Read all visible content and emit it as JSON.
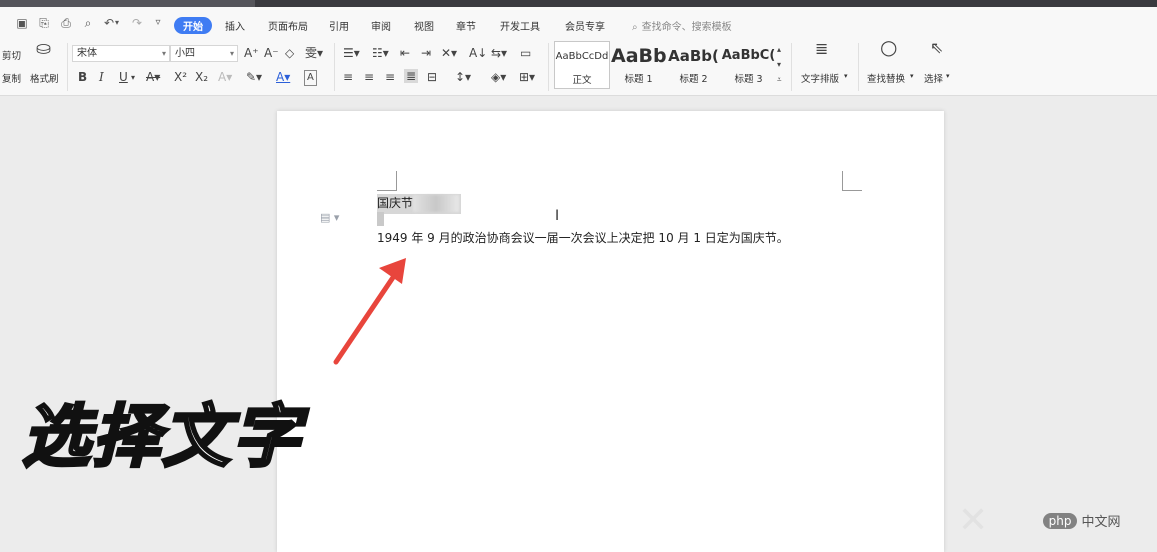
{
  "tabs": [
    {
      "id": "start",
      "label": "开始",
      "active": true
    },
    {
      "id": "insert",
      "label": "插入"
    },
    {
      "id": "layout",
      "label": "页面布局"
    },
    {
      "id": "ref",
      "label": "引用"
    },
    {
      "id": "review",
      "label": "审阅"
    },
    {
      "id": "view",
      "label": "视图"
    },
    {
      "id": "section",
      "label": "章节"
    },
    {
      "id": "dev",
      "label": "开发工具"
    },
    {
      "id": "member",
      "label": "会员专享"
    }
  ],
  "search_cmd": "查找命令、搜索模板",
  "clipboard": {
    "cut": "剪切",
    "copy": "复制",
    "format_painter": "格式刷"
  },
  "font": {
    "name": "宋体",
    "size": "小四"
  },
  "format_buttons": {
    "bold": "B",
    "italic": "I",
    "underline": "U",
    "superscript": "X²",
    "subscript": "X₂"
  },
  "styles": [
    {
      "preview": "AaBbCcDd",
      "name": "正文"
    },
    {
      "preview": "AaBb",
      "name": "标题 1"
    },
    {
      "preview": "AaBb(",
      "name": "标题 2"
    },
    {
      "preview": "AaBbC(",
      "name": "标题 3"
    }
  ],
  "text_layout": "文字排版",
  "find_replace": "查找替换",
  "select": "选择",
  "document": {
    "title_visible": "国庆节",
    "body": "1949 年 9 月的政治协商会议一届一次会议上决定把 10 月 1 日定为国庆节。"
  },
  "caption": "选择文字",
  "watermark": {
    "site": "php",
    "cn": "中文网"
  },
  "colors": {
    "accent": "#3f7cf3",
    "arrow": "#e8453c"
  }
}
